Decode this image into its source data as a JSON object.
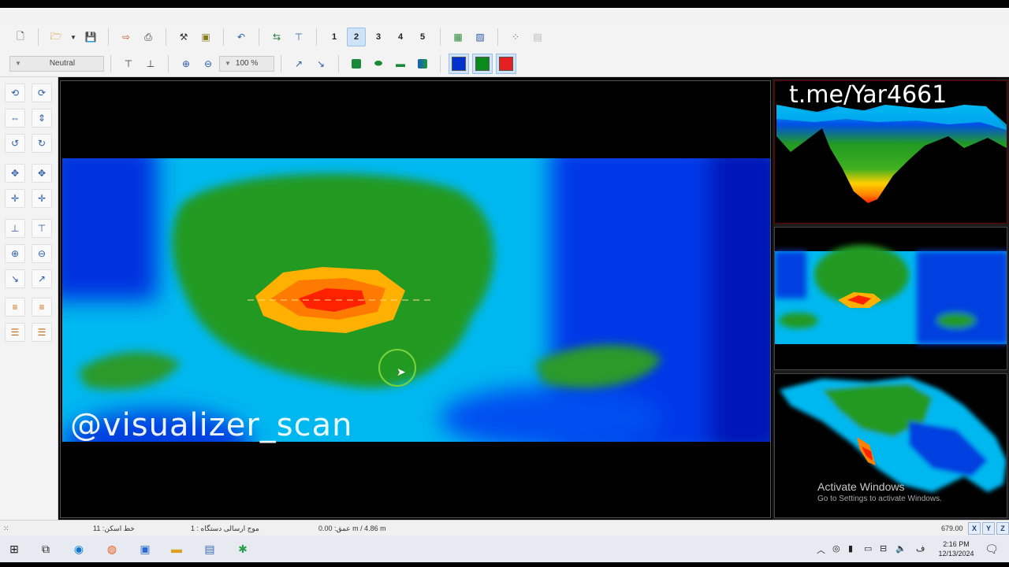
{
  "toolbar1": {
    "numbers": [
      "1",
      "2",
      "3",
      "4",
      "5"
    ],
    "active_number": "2"
  },
  "toolbar2": {
    "mode_select": "Neutral",
    "zoom_select": "100 %",
    "palette_colors": [
      "#0033cc",
      "#0a8a1a",
      "#e52020"
    ]
  },
  "main_view": {
    "watermark": "@visualizer_scan",
    "heatmap_palette": [
      "#0010b0",
      "#0030e0",
      "#0090f0",
      "#00d0f0",
      "#209a20",
      "#40b020",
      "#ffd000",
      "#ff8000",
      "#ff2000"
    ]
  },
  "right_panels": {
    "watermark": "t.me/Yar4661",
    "activate_title": "Activate Windows",
    "activate_subtitle": "Go to Settings to activate Windows."
  },
  "status_bar": {
    "scan_line": "خط اسکن: 11",
    "device_wave": "موج ارسالی دستگاه : 1",
    "depth": "عمق: 0.00 m / 4.86 m",
    "value": "679.00",
    "axis_buttons": [
      "X",
      "Y",
      "Z"
    ]
  },
  "taskbar": {
    "time": "2:16 PM",
    "date": "12/13/2024"
  }
}
